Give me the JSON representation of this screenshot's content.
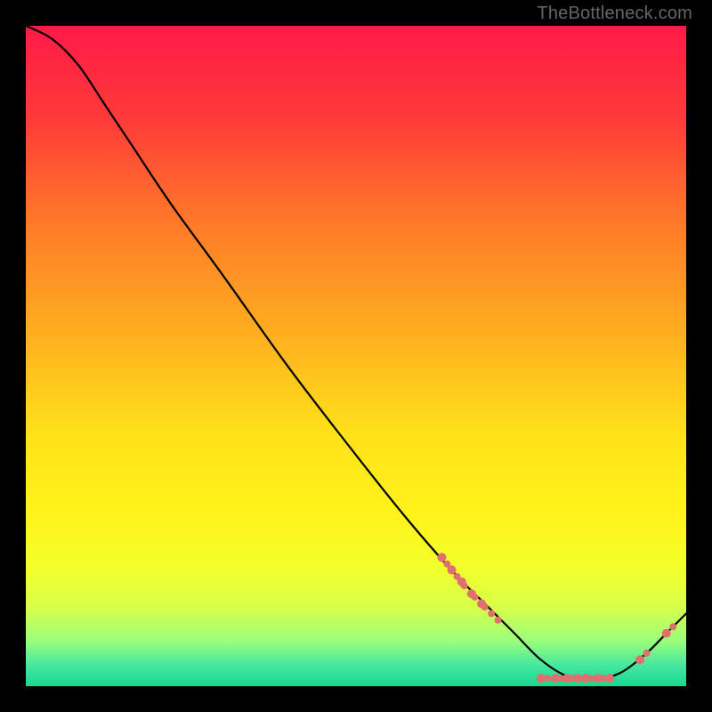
{
  "watermark": "TheBottleneck.com",
  "chart_data": {
    "type": "line",
    "title": "",
    "xlabel": "",
    "ylabel": "",
    "xlim": [
      0,
      100
    ],
    "ylim": [
      0,
      100
    ],
    "gradient_stops": [
      {
        "offset": 0.0,
        "color": "#ff1a48"
      },
      {
        "offset": 0.14,
        "color": "#ff3a3a"
      },
      {
        "offset": 0.3,
        "color": "#ff7a28"
      },
      {
        "offset": 0.48,
        "color": "#ffb31f"
      },
      {
        "offset": 0.62,
        "color": "#ffe21a"
      },
      {
        "offset": 0.74,
        "color": "#fff31a"
      },
      {
        "offset": 0.82,
        "color": "#f3ff2a"
      },
      {
        "offset": 0.88,
        "color": "#d8ff4a"
      },
      {
        "offset": 0.93,
        "color": "#9dff7a"
      },
      {
        "offset": 0.97,
        "color": "#43e6a0"
      },
      {
        "offset": 1.0,
        "color": "#17d98f"
      }
    ],
    "curve": [
      {
        "x": 0,
        "y": 100
      },
      {
        "x": 4,
        "y": 98
      },
      {
        "x": 8,
        "y": 94
      },
      {
        "x": 12,
        "y": 88
      },
      {
        "x": 16,
        "y": 82
      },
      {
        "x": 22,
        "y": 73
      },
      {
        "x": 30,
        "y": 62
      },
      {
        "x": 40,
        "y": 48
      },
      {
        "x": 50,
        "y": 35
      },
      {
        "x": 58,
        "y": 25
      },
      {
        "x": 65,
        "y": 17
      },
      {
        "x": 70,
        "y": 12
      },
      {
        "x": 74,
        "y": 8
      },
      {
        "x": 78,
        "y": 4
      },
      {
        "x": 82,
        "y": 1.5
      },
      {
        "x": 86,
        "y": 1
      },
      {
        "x": 90,
        "y": 2
      },
      {
        "x": 94,
        "y": 5
      },
      {
        "x": 97,
        "y": 8
      },
      {
        "x": 100,
        "y": 11
      }
    ],
    "markers": {
      "color": "#e07070",
      "radius_small": 4,
      "radius_large": 5,
      "points": [
        {
          "x": 63.0,
          "y": 19.5,
          "r": 5
        },
        {
          "x": 63.8,
          "y": 18.5,
          "r": 4
        },
        {
          "x": 64.5,
          "y": 17.6,
          "r": 5
        },
        {
          "x": 65.3,
          "y": 16.6,
          "r": 4
        },
        {
          "x": 66.0,
          "y": 15.8,
          "r": 5
        },
        {
          "x": 66.4,
          "y": 15.2,
          "r": 4
        },
        {
          "x": 67.5,
          "y": 14.0,
          "r": 5
        },
        {
          "x": 68.0,
          "y": 13.5,
          "r": 4
        },
        {
          "x": 69.0,
          "y": 12.5,
          "r": 5
        },
        {
          "x": 69.5,
          "y": 12.0,
          "r": 4
        },
        {
          "x": 70.5,
          "y": 11.0,
          "r": 4
        },
        {
          "x": 71.5,
          "y": 10.0,
          "r": 4
        },
        {
          "x": 78.0,
          "y": 1.2,
          "r": 5
        },
        {
          "x": 79.0,
          "y": 1.2,
          "r": 4
        },
        {
          "x": 80.2,
          "y": 1.2,
          "r": 5
        },
        {
          "x": 81.0,
          "y": 1.2,
          "r": 4
        },
        {
          "x": 82.0,
          "y": 1.2,
          "r": 5
        },
        {
          "x": 82.8,
          "y": 1.2,
          "r": 4
        },
        {
          "x": 83.6,
          "y": 1.2,
          "r": 5
        },
        {
          "x": 84.8,
          "y": 1.2,
          "r": 5
        },
        {
          "x": 85.6,
          "y": 1.2,
          "r": 4
        },
        {
          "x": 86.6,
          "y": 1.2,
          "r": 5
        },
        {
          "x": 87.4,
          "y": 1.2,
          "r": 4
        },
        {
          "x": 88.4,
          "y": 1.2,
          "r": 5
        },
        {
          "x": 93.0,
          "y": 4.0,
          "r": 5
        },
        {
          "x": 94.0,
          "y": 5.0,
          "r": 4
        },
        {
          "x": 97.0,
          "y": 8.0,
          "r": 5
        },
        {
          "x": 98.0,
          "y": 9.0,
          "r": 4
        }
      ]
    }
  }
}
